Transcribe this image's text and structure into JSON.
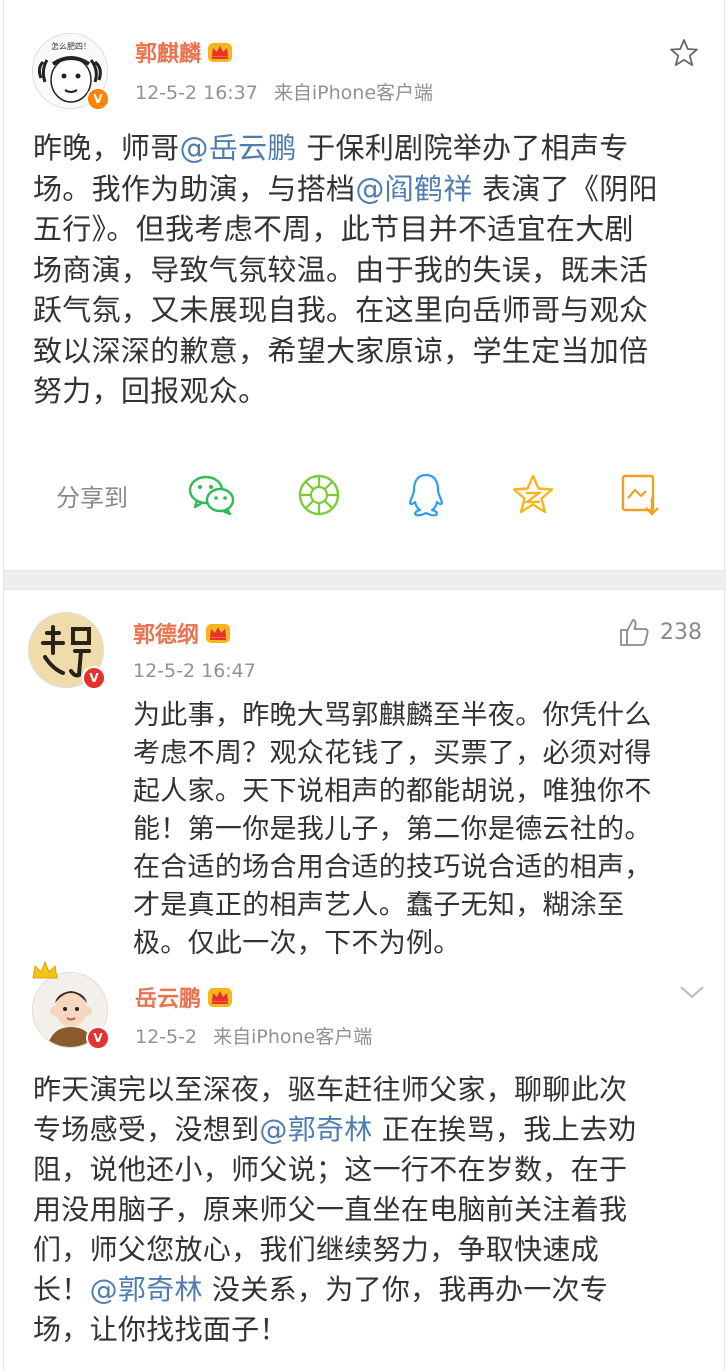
{
  "post": {
    "author": "郭麒麟",
    "time": "12-5-2 16:37",
    "source": "来自iPhone客户端",
    "avatar_caption": "怎么肥四！",
    "segments": [
      {
        "t": "昨晚，师哥"
      },
      {
        "t": "@岳云鹏",
        "at": true
      },
      {
        "t": " 于保利剧院举办了相声专场。我作为助演，与搭档"
      },
      {
        "t": "@阎鹤祥",
        "at": true
      },
      {
        "t": " 表演了《阴阳五行》。但我考虑不周，此节目并不适宜在大剧场商演，导致气氛较温。由于我的失误，既未活跃气氛，又未展现自我。在这里向岳师哥与观众致以深深的歉意，希望大家原谅，学生定当加倍努力，回报观众。"
      }
    ],
    "lines": [
      [
        {
          "t": "昨晚，师哥"
        },
        {
          "t": "@岳云鹏",
          "at": true
        },
        {
          "t": " 于保利剧院举办了相声专"
        }
      ],
      [
        {
          "t": "场。我作为助演，与搭档"
        },
        {
          "t": "@阎鹤祥",
          "at": true
        },
        {
          "t": " 表演了《阴阳"
        }
      ],
      [
        {
          "t": "五行》。但我考虑不周，此节目并不适宜在大剧"
        }
      ],
      [
        {
          "t": "场商演，导致气氛较温。由于我的失误，既未活"
        }
      ],
      [
        {
          "t": "跃气氛，又未展现自我。在这里向岳师哥与观众"
        }
      ],
      [
        {
          "t": "致以深深的歉意，希望大家原谅，学生定当加倍"
        }
      ],
      [
        {
          "t": "努力，回报观众。"
        }
      ]
    ],
    "share_label": "分享到",
    "share_targets": [
      "wechat-icon",
      "moments-icon",
      "qq-icon",
      "qzone-icon",
      "weibo-save-icon"
    ]
  },
  "comment1": {
    "author": "郭德纲",
    "time": "12-5-2 16:47",
    "likes": "238",
    "lines": [
      "为此事，昨晚大骂郭麒麟至半夜。你凭什么",
      "考虑不周？观众花钱了，买票了，必须对得",
      "起人家。天下说相声的都能胡说，唯独你不",
      "能！第一你是我儿子，第二你是德云社的。",
      "在合适的场合用合适的技巧说合适的相声，",
      "才是真正的相声艺人。蠢子无知，糊涂至",
      "极。仅此一次，下不为例。"
    ]
  },
  "comment2": {
    "author": "岳云鹏",
    "time": "12-5-2",
    "source": "来自iPhone客户端",
    "lines": [
      [
        {
          "t": "昨天演完以至深夜，驱车赶往师父家，聊聊此次"
        }
      ],
      [
        {
          "t": "专场感受，没想到"
        },
        {
          "t": "@郭奇林",
          "at": true
        },
        {
          "t": " 正在挨骂，我上去劝"
        }
      ],
      [
        {
          "t": "阻，说他还小，师父说；这一行不在岁数，在于"
        }
      ],
      [
        {
          "t": "用没用脑子，原来师父一直坐在电脑前关注着我"
        }
      ],
      [
        {
          "t": "们，师父您放心，我们继续努力，争取快速成"
        }
      ],
      [
        {
          "t": "长！"
        },
        {
          "t": "@郭奇林",
          "at": true
        },
        {
          "t": " 没关系，为了你，我再办一次专"
        }
      ],
      [
        {
          "t": "场，让你找找面子！"
        }
      ]
    ]
  },
  "colors": {
    "username": "#eb7350",
    "mention": "#507daf",
    "meta": "#929292",
    "verified_orange": "#ff8200",
    "verified_red": "#e6312c",
    "crown_gold": "#f5b51c"
  }
}
